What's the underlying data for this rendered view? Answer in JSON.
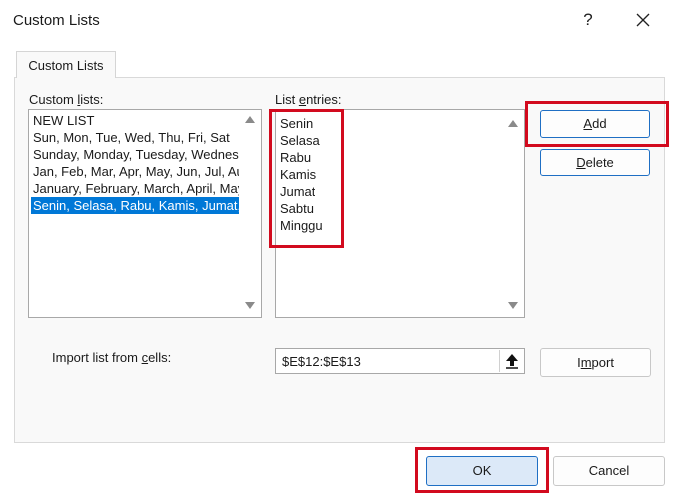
{
  "window": {
    "title": "Custom Lists",
    "help_label": "?"
  },
  "tabs": [
    {
      "label": "Custom Lists",
      "active": true
    }
  ],
  "custom_lists": {
    "label_pre": "Custom ",
    "label_accel": "l",
    "label_post": "ists:",
    "items": [
      "NEW LIST",
      "Sun, Mon, Tue, Wed, Thu, Fri, Sat",
      "Sunday, Monday, Tuesday, Wednesday, Thursday, Friday, Saturday",
      "Jan, Feb, Mar, Apr, May, Jun, Jul, Aug, Sep, Oct, Nov, Dec",
      "January, February, March, April, May, June, July, August, September, October, November, December",
      "Senin, Selasa, Rabu, Kamis, Jumat, Sabtu, Minggu"
    ],
    "selected_index": 5
  },
  "list_entries": {
    "label_pre": "List ",
    "label_accel": "e",
    "label_post": "ntries:",
    "items": [
      "Senin",
      "Selasa",
      "Rabu",
      "Kamis",
      "Jumat",
      "Sabtu",
      "Minggu"
    ]
  },
  "buttons": {
    "add_accel": "A",
    "add_rest": "dd",
    "delete_accel": "D",
    "delete_rest": "elete",
    "import_pre": "I",
    "import_accel": "m",
    "import_post": "port",
    "ok": "OK",
    "cancel": "Cancel"
  },
  "import": {
    "label_pre": "Import list from ",
    "label_accel": "c",
    "label_post": "ells:",
    "value": "$E$12:$E$13"
  },
  "colors": {
    "highlight_box": "#d20a1e",
    "selection": "#0078d7",
    "accent": "#1f6fc4"
  }
}
